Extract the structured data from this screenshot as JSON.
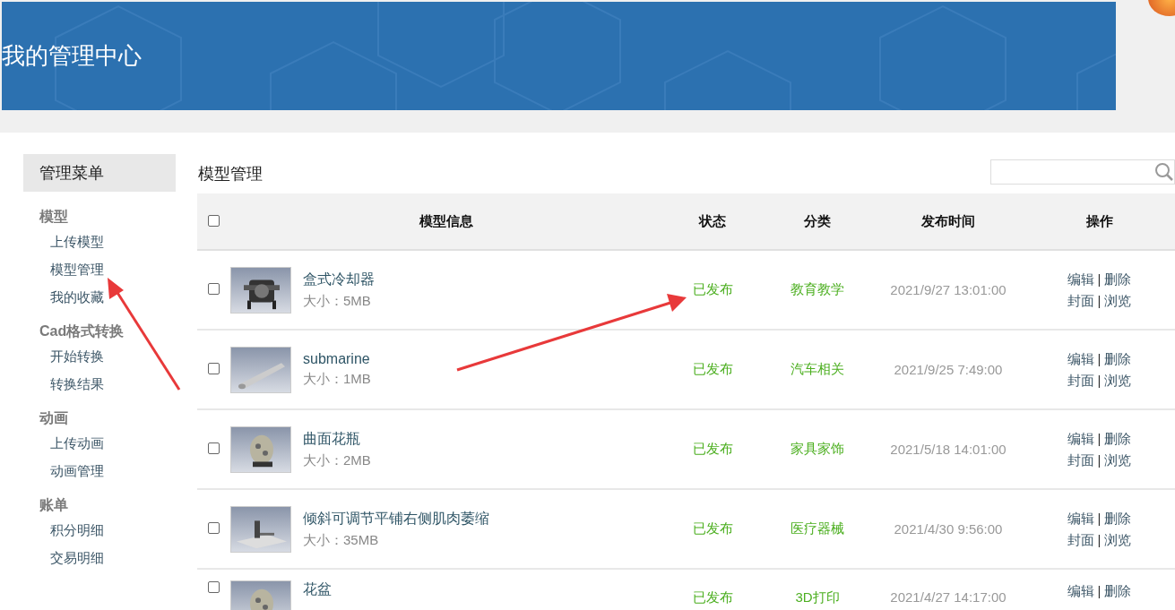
{
  "header": {
    "title": "我的管理中心"
  },
  "sidebar": {
    "title": "管理菜单",
    "groups": [
      {
        "heading": "模型",
        "items": [
          "上传模型",
          "模型管理",
          "我的收藏"
        ]
      },
      {
        "heading": "Cad格式转换",
        "items": [
          "开始转换",
          "转换结果"
        ]
      },
      {
        "heading": "动画",
        "items": [
          "上传动画",
          "动画管理"
        ]
      },
      {
        "heading": "账单",
        "items": [
          "积分明细",
          "交易明细"
        ]
      }
    ]
  },
  "main": {
    "title": "模型管理",
    "table": {
      "select_all_checked": false,
      "columns": [
        "模型信息",
        "状态",
        "分类",
        "发布时间",
        "操作"
      ],
      "rows": [
        {
          "checked": false,
          "name": "盒式冷却器",
          "size": "大小：5MB",
          "status": "已发布",
          "category": "教育教学",
          "time": "2021/9/27 13:01:00",
          "actions": [
            {
              "left": "编辑",
              "sep": "|",
              "right": "删除"
            },
            {
              "left": "封面",
              "sep": "|",
              "right": "浏览"
            }
          ]
        },
        {
          "checked": false,
          "name": "submarine",
          "size": "大小：1MB",
          "status": "已发布",
          "category": "汽车相关",
          "time": "2021/9/25 7:49:00",
          "actions": [
            {
              "left": "编辑",
              "sep": "|",
              "right": "删除"
            },
            {
              "left": "封面",
              "sep": "|",
              "right": "浏览"
            }
          ]
        },
        {
          "checked": false,
          "name": "曲面花瓶",
          "size": "大小：2MB",
          "status": "已发布",
          "category": "家具家饰",
          "time": "2021/5/18 14:01:00",
          "actions": [
            {
              "left": "编辑",
              "sep": "|",
              "right": "删除"
            },
            {
              "left": "封面",
              "sep": "|",
              "right": "浏览"
            }
          ]
        },
        {
          "checked": false,
          "name": "倾斜可调节平铺右侧肌肉萎缩",
          "size": "大小：35MB",
          "status": "已发布",
          "category": "医疗器械",
          "time": "2021/4/30 9:56:00",
          "actions": [
            {
              "left": "编辑",
              "sep": "|",
              "right": "删除"
            },
            {
              "left": "封面",
              "sep": "|",
              "right": "浏览"
            }
          ]
        },
        {
          "checked": false,
          "name": "花盆",
          "status": "已发布",
          "category": "3D打印",
          "time": "2021/4/27 14:17:00",
          "actions": [
            {
              "left": "编辑",
              "sep": "|",
              "right": "删除"
            }
          ]
        }
      ]
    }
  }
}
